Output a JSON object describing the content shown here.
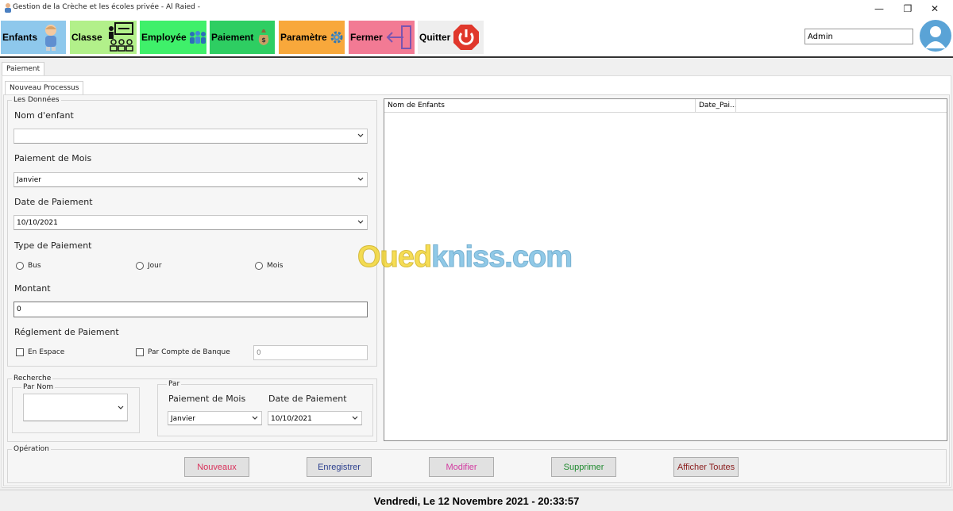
{
  "window": {
    "title": "Gestion de la Crèche et les écoles privée - Al Raied -",
    "controls": {
      "minimize": "—",
      "maximize": "❐",
      "close": "✕"
    }
  },
  "toolbar": {
    "buttons": [
      {
        "label": "Enfants",
        "color": "#8ec8ec",
        "icon": "child-icon"
      },
      {
        "label": "Classe",
        "color": "#b2f08a",
        "icon": "classroom-icon"
      },
      {
        "label": "Employée",
        "color": "#3ff06a",
        "icon": "employees-icon"
      },
      {
        "label": "Paiement",
        "color": "#2ece62",
        "icon": "money-bag-icon"
      },
      {
        "label": "Paramètre",
        "color": "#f8a83b",
        "icon": "gear-icon"
      },
      {
        "label": "Fermer",
        "color": "#f27a94",
        "icon": "exit-arrow-icon"
      },
      {
        "label": "Quitter",
        "color": "#eeeeee",
        "icon": "power-icon"
      }
    ],
    "user_value": "Admin"
  },
  "tabs": {
    "outer": "Paiement",
    "inner": "Nouveau Processus"
  },
  "form": {
    "group_title": "Les Données",
    "nom_enfant_label": "Nom d'enfant",
    "nom_enfant_value": "",
    "mois_label": "Paiement de Mois",
    "mois_value": "Janvier",
    "date_label": "Date de Paiement",
    "date_value": "10/10/2021",
    "type_label": "Type de Paiement",
    "type_options": [
      "Bus",
      "Jour",
      "Mois"
    ],
    "montant_label": "Montant",
    "montant_value": "0",
    "reglement_label": "Réglement de Paiement",
    "reglement_options": [
      "En Espace",
      "Par Compte de Banque"
    ],
    "banque_value": "0"
  },
  "search": {
    "group_title": "Recherche",
    "par_nom_title": "Par Nom",
    "par_nom_value": "",
    "par_title": "Par",
    "mois_label": "Paiement de Mois",
    "mois_value": "Janvier",
    "date_label": "Date de Paiement",
    "date_value": "10/10/2021"
  },
  "grid": {
    "columns": [
      "Nom de Enfants",
      "Date_Pai..."
    ]
  },
  "operation": {
    "group_title": "Opération",
    "buttons": [
      {
        "label": "Nouveaux",
        "color": "#d9305a"
      },
      {
        "label": "Enregistrer",
        "color": "#2b3f8e"
      },
      {
        "label": "Modifier",
        "color": "#d23aa0"
      },
      {
        "label": "Supprimer",
        "color": "#1e8a2e"
      },
      {
        "label": "Afficher Toutes",
        "color": "#8a1c1c"
      }
    ]
  },
  "status_text": "Vendredi, Le 12 Novembre 2021 - 20:33:57",
  "watermark": {
    "part1": "Oued",
    "part2": "kniss",
    "part3": ".com"
  },
  "colors": {
    "watermark_yellow": "#f3d21b",
    "watermark_blue": "#6bb7e0"
  }
}
